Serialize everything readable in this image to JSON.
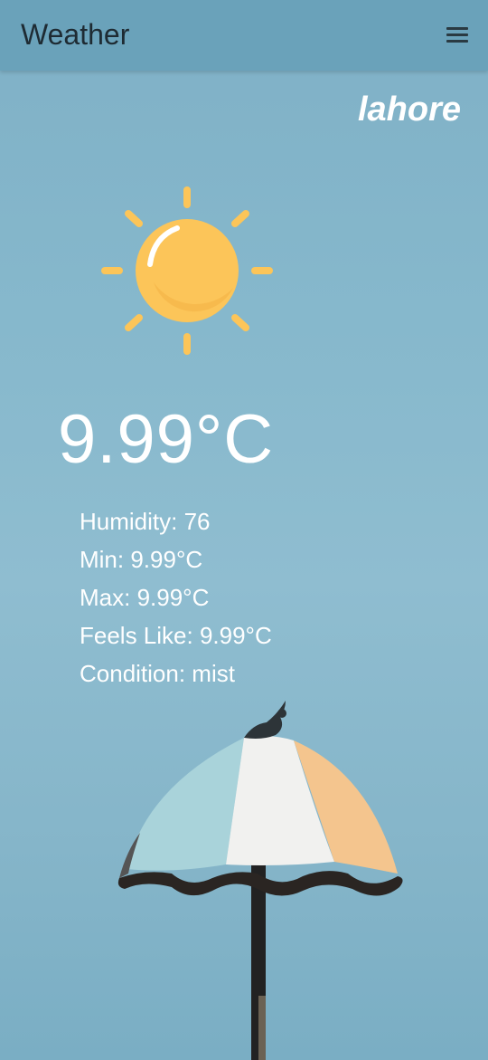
{
  "appbar": {
    "title": "Weather",
    "menu_icon": "hamburger-menu-icon"
  },
  "city": "lahore",
  "weather_icon": "sun-icon",
  "temperature": "9.99°C",
  "details": {
    "humidity": "Humidity: 76",
    "min": "Min: 9.99°C",
    "max": "Max: 9.99°C",
    "feels_like": "Feels Like: 9.99°C",
    "condition": "Condition: mist"
  },
  "colors": {
    "appbar": "#6aa2ba",
    "background": "#86b8cc",
    "sun": "#fcc559",
    "text": "#ffffff"
  }
}
